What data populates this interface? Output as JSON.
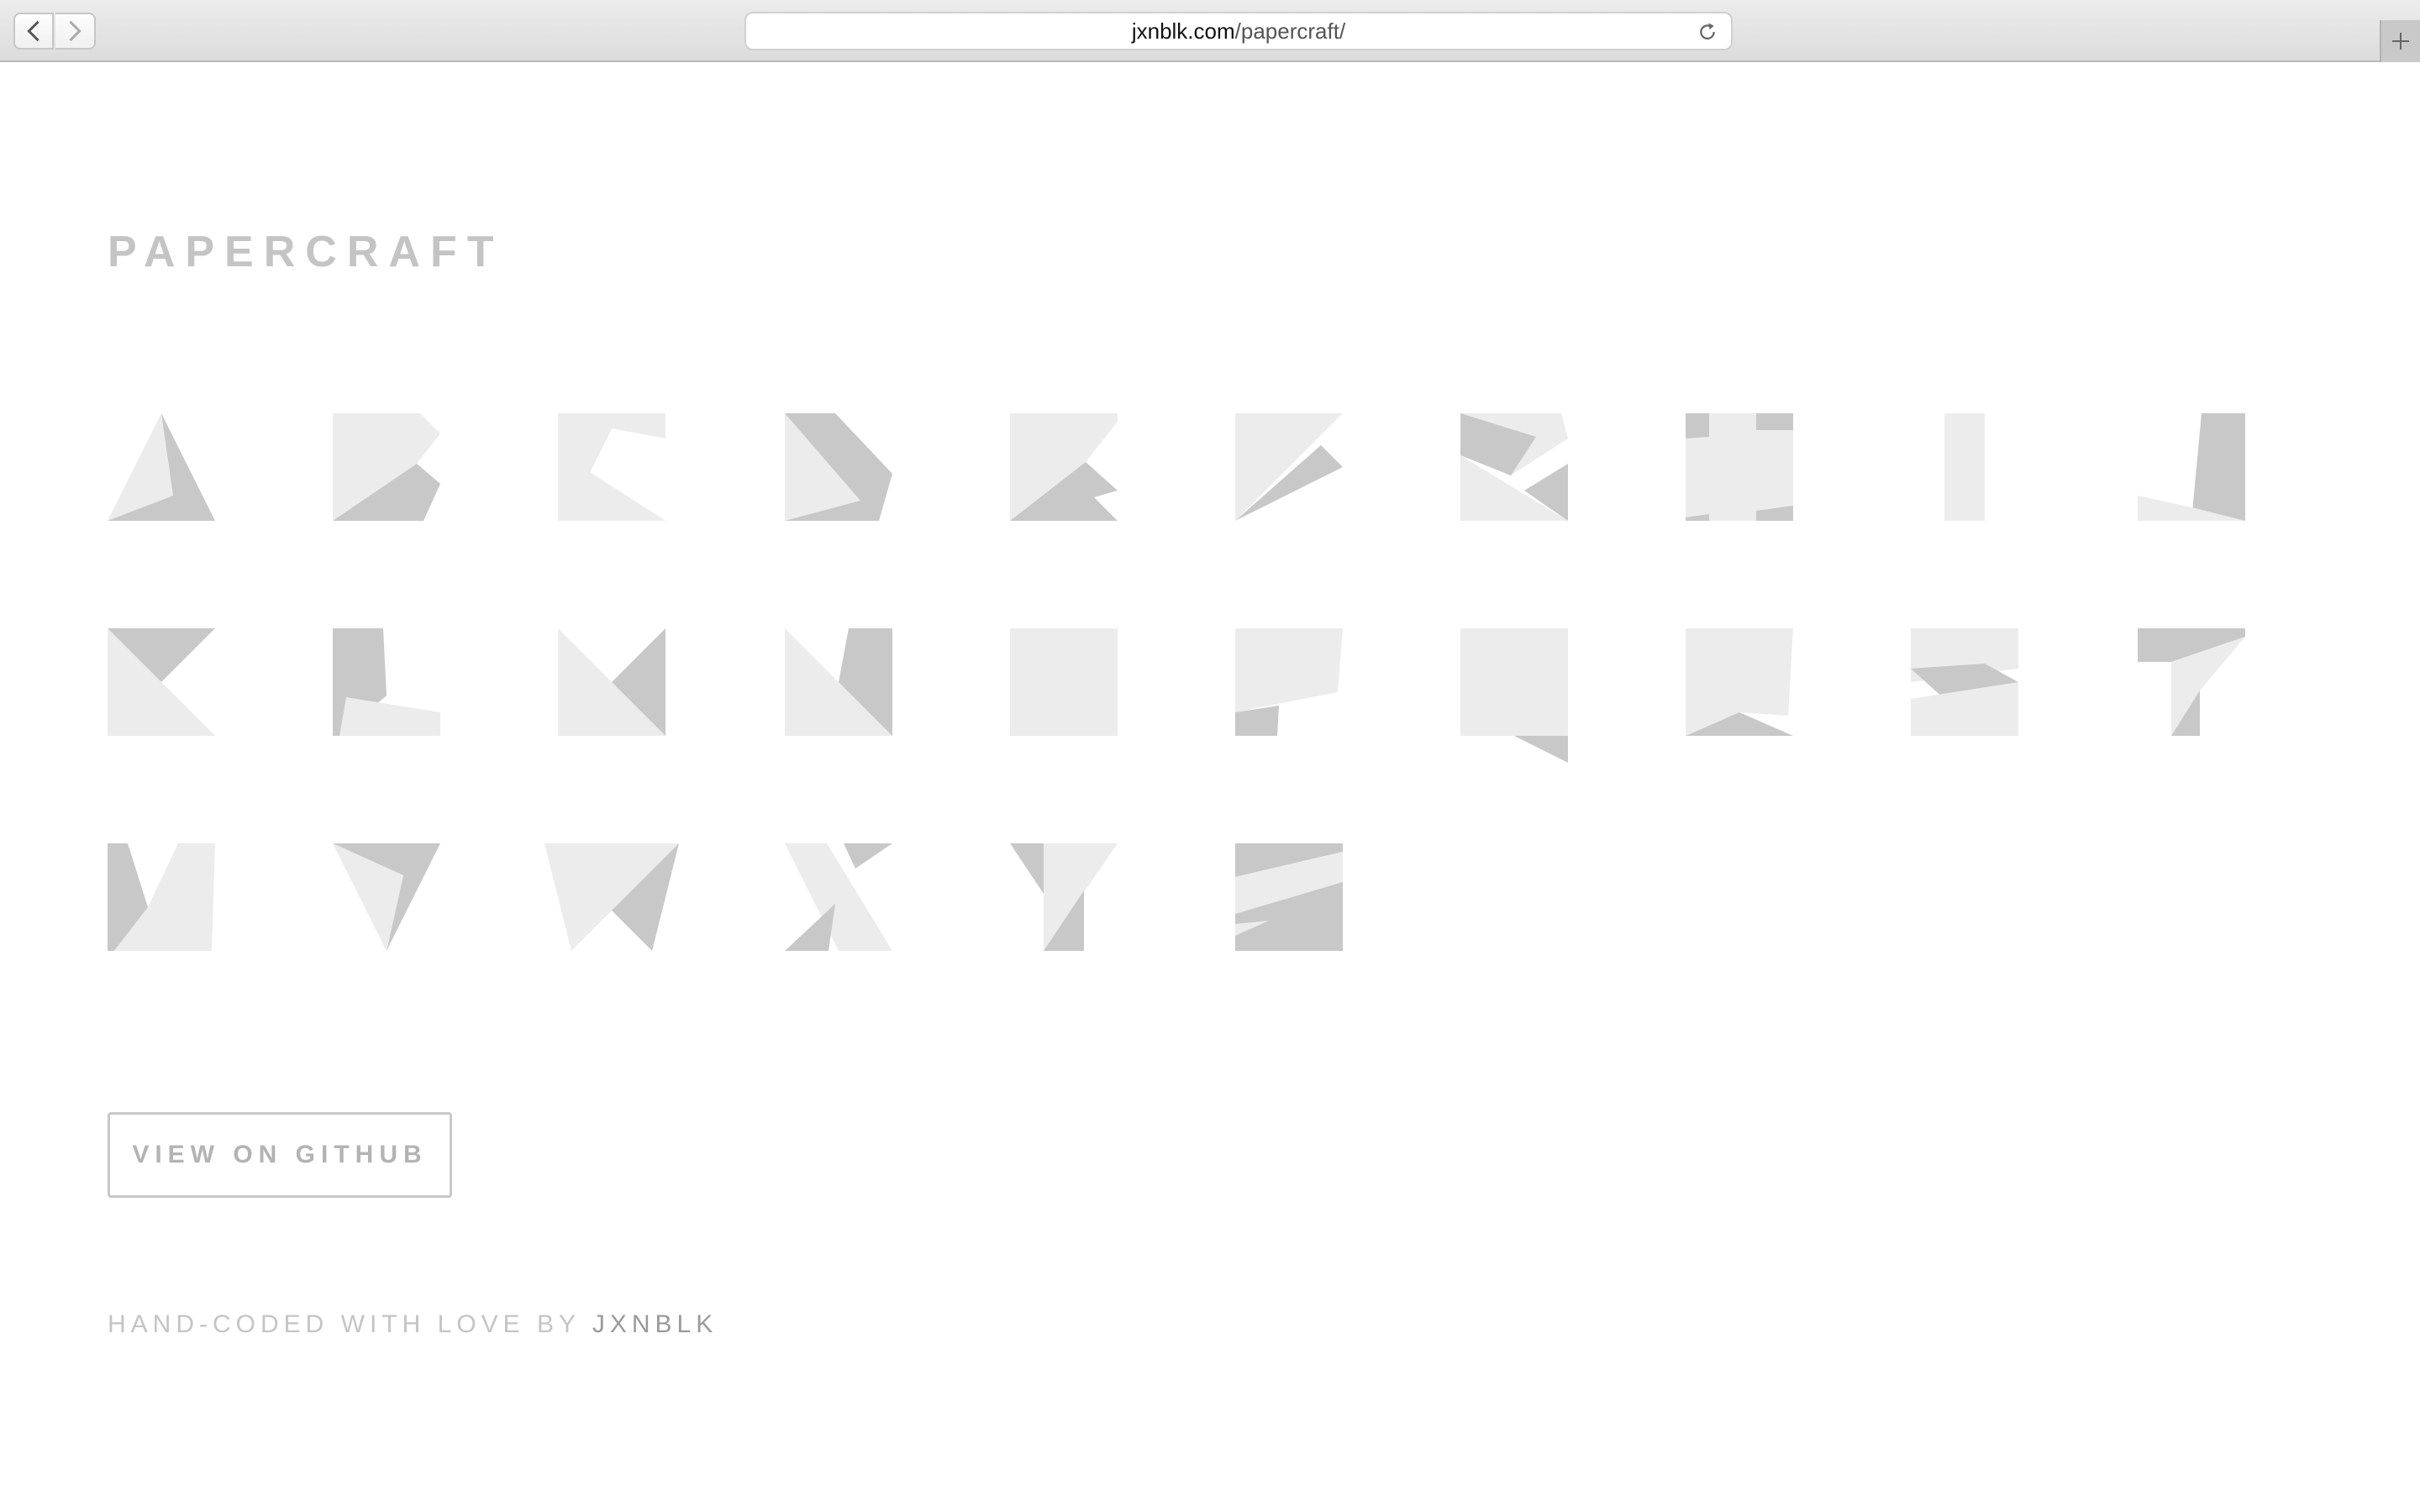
{
  "browser": {
    "url_host": "jxnblk.com",
    "url_path": "/papercraft/",
    "back_icon": "chevron-left-icon",
    "forward_icon": "chevron-right-icon",
    "reload_icon": "reload-icon",
    "new_tab_icon": "plus-icon"
  },
  "page": {
    "title": "PAPERCRAFT",
    "github_button": "VIEW ON GITHUB",
    "footer_text": "HAND-CODED WITH LOVE BY ",
    "footer_link": "JXNBLK"
  },
  "letters": [
    "A",
    "B",
    "C",
    "D",
    "E",
    "F",
    "G",
    "H",
    "I",
    "J",
    "K",
    "L",
    "M",
    "N",
    "O",
    "P",
    "Q",
    "R",
    "S",
    "T",
    "V",
    "W",
    "X",
    "Y",
    "Z"
  ],
  "colors": {
    "light": "#ececec",
    "dark": "#c8c8c8",
    "text": "#c4c4c4"
  }
}
